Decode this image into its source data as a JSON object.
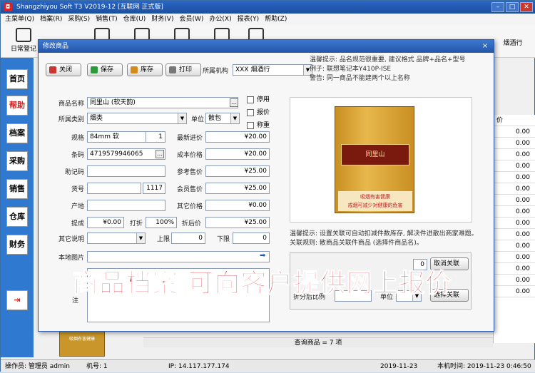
{
  "app": {
    "title": "Shangzhiyou Soft T3 V2019-12 [互联网 正式版]"
  },
  "menu": [
    "主菜单(Q)",
    "档案(R)",
    "采购(S)",
    "销售(T)",
    "仓库(U)",
    "财务(V)",
    "会员(W)",
    "办公(X)",
    "报表(Y)",
    "帮助(Z)"
  ],
  "toolbar": {
    "first_label": "日常登记",
    "right_label": "烟酒行"
  },
  "leftnav": [
    "首页",
    "帮助",
    "档案",
    "采购",
    "销售",
    "仓库",
    "财务"
  ],
  "bg_grid": {
    "header": "价",
    "values": [
      "0.00",
      "0.00",
      "0.00",
      "0.00",
      "0.00",
      "0.00",
      "0.00",
      "0.00",
      "0.00",
      "0.00",
      "0.00",
      "0.00",
      "0.00",
      "0.00",
      "0.00"
    ]
  },
  "bg_count": "查询商品 = 7 项",
  "thumb_text": "吸烟有害健康",
  "status": {
    "operator": "操作员: 管理员 admin",
    "machine": "机号: 1",
    "ip": "IP: 14.117.177.174",
    "date": "2019-11-23",
    "time_label": "本机时间: 2019-11-23 0:46:50"
  },
  "dialog": {
    "title": "修改商品",
    "close": "×",
    "buttons": {
      "close": "关闭",
      "save": "保存",
      "stock": "库存",
      "print": "打印"
    },
    "org_label": "所属机构",
    "org_value": "XXX 烟酒行",
    "hint": [
      "温馨提示: 品名规范很重要, 建议格式 品牌+品名+型号",
      "例子: 联想笔记本Y410P-ISE",
      "警告: 同一商品不能建两个以上名称"
    ],
    "fields": {
      "name_label": "商品名称",
      "name": "同里山 (软天韵)",
      "category_label": "所属类别",
      "category": "烟类",
      "unit_label": "单位",
      "unit": "散包",
      "spec_label": "规格",
      "spec": "84mm 软",
      "spec_qty": "1",
      "barcode_label": "条码",
      "barcode": "4719579946065",
      "memo_code_label": "助记码",
      "item_no_label": "货号",
      "item_no": "1117",
      "origin_label": "产地",
      "commission_label": "提成",
      "commission": "¥0.00",
      "discount_label": "打折",
      "discount": "100%",
      "discount_price_label": "折后价",
      "discount_price": "¥25.00",
      "other_desc_label": "其它说明",
      "upper_label": "上限",
      "upper": "0",
      "lower_label": "下限",
      "lower": "0",
      "image_label": "本地图片",
      "memo_label": "注",
      "latest_in_label": "最新进价",
      "latest_in": "¥20.00",
      "cost_label": "成本价格",
      "cost": "¥20.00",
      "ref_price_label": "参考售价",
      "ref_price": "¥25.00",
      "member_price_label": "会员售价",
      "member_price": "¥25.00",
      "other_price_label": "其它价格",
      "other_price": "¥0.00"
    },
    "checks": {
      "disabled": "停用",
      "quote": "报价",
      "weigh": "称重"
    },
    "image": {
      "brand": "同里山",
      "warning_1": "吸烟有害健康",
      "warning_2": "戒烟可减少对健康的危害"
    },
    "hint2": [
      "温馨提示: 设置关联可自动扣减件数库存, 解决件进散出商家难题。",
      "关联规则: 散商品关联件商品 (选择件商品名)。"
    ],
    "relation": {
      "qty": "0",
      "btn_cancel": "取消关联",
      "ratio_label": "折分后比例",
      "unit_label": "单位",
      "btn_select": "选择关联"
    }
  },
  "overlay_text": "商品档案 可向客户提供网上报价"
}
